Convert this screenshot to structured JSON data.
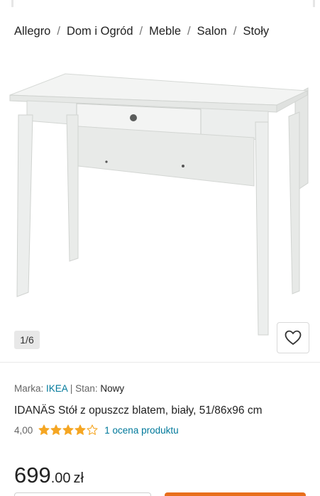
{
  "breadcrumb": {
    "items": [
      "Allegro",
      "Dom i Ogród",
      "Meble",
      "Salon",
      "Stoły"
    ],
    "separator": "/"
  },
  "gallery": {
    "counter": "1/6",
    "favorite_icon": "heart-outline-icon"
  },
  "product": {
    "brand_label": "Marka:",
    "brand": "IKEA",
    "condition_separator": "|",
    "condition_label": "Stan:",
    "condition": "Nowy",
    "title": "IDANÄS Stół z opuszcz blatem, biały, 51/86x96 cm",
    "rating_value": "4,00",
    "rating_stars": 4,
    "rating_max": 5,
    "reviews_text": "1 ocena produktu",
    "price_int": "699",
    "price_dec": ".00",
    "currency": "zł"
  },
  "colors": {
    "link": "#00799b",
    "star": "#f5a623",
    "buy_button": "#e86f1b",
    "text": "#222222"
  }
}
